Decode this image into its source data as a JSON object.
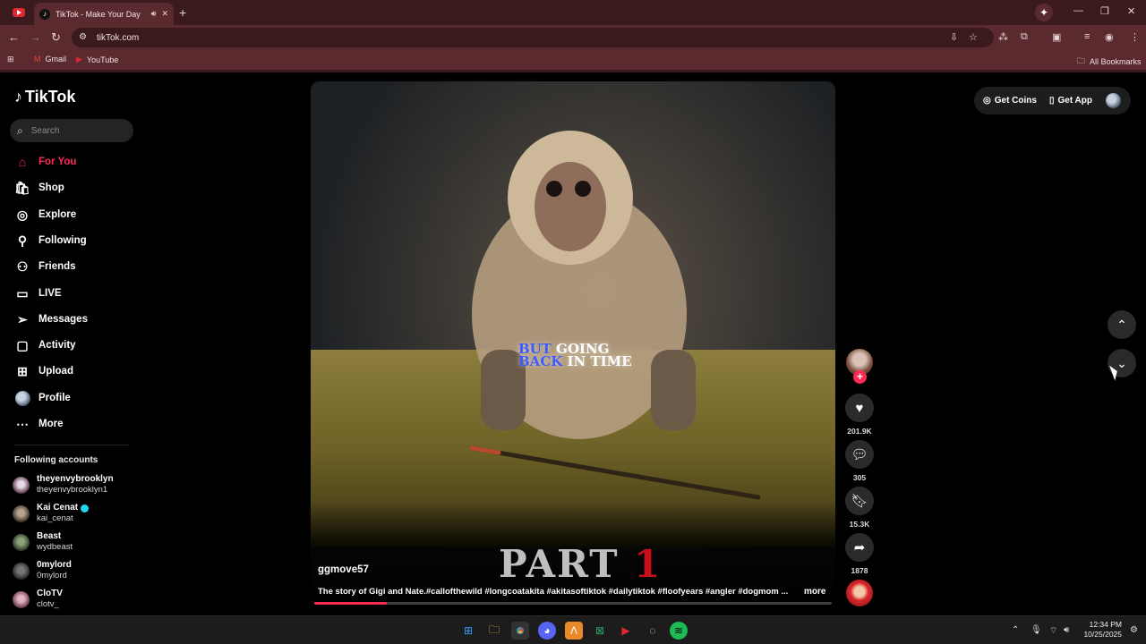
{
  "browser": {
    "tab_title": "TikTok - Make Your Day",
    "url": "tikTok.com",
    "bookmarks": [
      {
        "label": "Gmail",
        "icon": "gmail-icon"
      },
      {
        "label": "YouTube",
        "icon": "youtube-icon"
      }
    ],
    "all_bookmarks": "All Bookmarks"
  },
  "tiktok": {
    "logo": "TikTok",
    "search_placeholder": "Search",
    "nav": [
      {
        "label": "For You",
        "icon": "home-icon",
        "active": true
      },
      {
        "label": "Shop",
        "icon": "shop-icon"
      },
      {
        "label": "Explore",
        "icon": "compass-icon"
      },
      {
        "label": "Following",
        "icon": "following-icon"
      },
      {
        "label": "Friends",
        "icon": "friends-icon"
      },
      {
        "label": "LIVE",
        "icon": "live-icon"
      },
      {
        "label": "Messages",
        "icon": "messages-icon"
      },
      {
        "label": "Activity",
        "icon": "activity-icon"
      },
      {
        "label": "Upload",
        "icon": "upload-icon"
      },
      {
        "label": "Profile",
        "icon": "profile-icon"
      },
      {
        "label": "More",
        "icon": "more-icon"
      }
    ],
    "following_title": "Following accounts",
    "accounts": [
      {
        "name": "theyenvybrooklyn",
        "handle": "theyenvybrooklyn1",
        "verified": false
      },
      {
        "name": "Kai Cenat",
        "handle": "kai_cenat",
        "verified": true
      },
      {
        "name": "Beast",
        "handle": "wydbeast",
        "verified": false
      },
      {
        "name": "0mylord",
        "handle": "0mylord",
        "verified": false
      },
      {
        "name": "CloTV",
        "handle": "clotv_",
        "verified": false
      }
    ],
    "video": {
      "overlay_blue_1": "BUT",
      "overlay_white_1": "GOING",
      "overlay_blue_2": "BACK",
      "overlay_white_2": "IN TIME",
      "part_text": "PART",
      "part_number": "1",
      "username": "ggmove57",
      "description": "The story of Gigi and Nate.#callofthewild #longcoatakita #akitasoftiktok #dailytiktok #floofyears #angler #dogmom ...",
      "more": "more",
      "progress": 0.14
    },
    "actions": {
      "likes": "201.9K",
      "comments": "305",
      "saves": "15.3K",
      "shares": "1878"
    },
    "top": {
      "get_coins": "Get Coins",
      "get_app": "Get App"
    }
  },
  "taskbar": {
    "time": "12:34 PM",
    "date": "10/25/2025"
  }
}
